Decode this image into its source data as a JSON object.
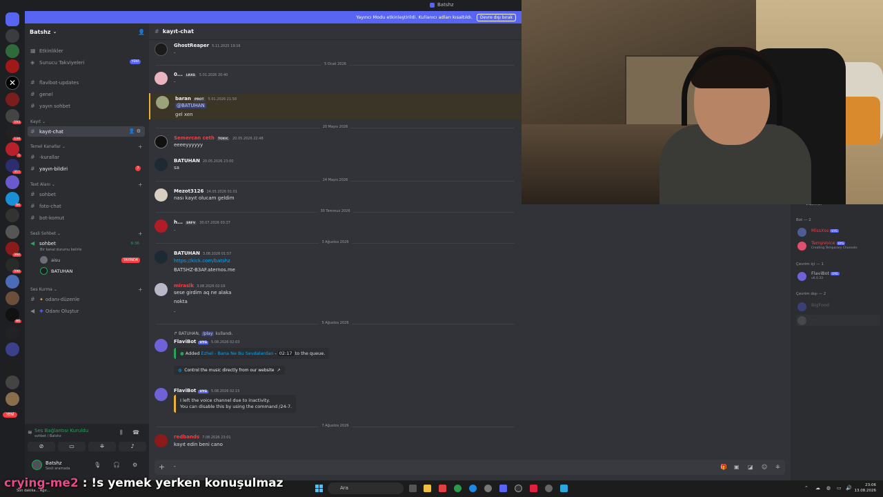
{
  "titlebar": {
    "title": "Batshz"
  },
  "notice": {
    "text": "Yayıncı Modu etkinleştirildi. Kullanıcı adları kısaltıldı.",
    "button": "Devre dışı bırak"
  },
  "rail": {
    "new_label": "YENİ",
    "badges": [
      "193",
      "134",
      "5",
      "86",
      "360",
      "590",
      "86",
      "311"
    ]
  },
  "server": {
    "name": "Batshz"
  },
  "sidebar": {
    "top_items": [
      {
        "label": "Etkinlikler"
      },
      {
        "label": "Sunucu Takviyeleri",
        "badge": "YENİ"
      }
    ],
    "channels_a": [
      "flavibot-updates",
      "genel",
      "yayın sohbet"
    ],
    "cat_kayit": "Kayıt",
    "active_channel": "kayıt-chat",
    "cat_temel": "Temel Kanallar",
    "channels_temel": [
      "-kurallar",
      "yayın-bildiri"
    ],
    "temel_badge": "7",
    "cat_text": "Text Alanı",
    "channels_text": [
      "sohbet",
      "foto-chat",
      "bot-komut"
    ],
    "cat_sesli": "Sesli Sohbet",
    "voice_channel": "sohbet",
    "voice_status": "Bir kanal durumu belirle",
    "voice_timer": "6:36",
    "voice_users": [
      {
        "name": "aisu",
        "badge": "YAYINDA"
      },
      {
        "name": "BATUHAN"
      }
    ],
    "cat_ses_kurma": "Ses Kurma",
    "channels_ses": [
      "odanı-düzenle",
      "Odanı Oluştur"
    ]
  },
  "voicebar": {
    "title": "Ses Bağlantısı Kuruldu",
    "sub": "sohbet / Batshz",
    "user": "Batshz",
    "user_status": "Sesli aramada"
  },
  "header": {
    "channel": "kayıt-chat"
  },
  "messages": [
    {
      "name": "GhostReaper",
      "time": "5.11.2025 19:16",
      "text": "."
    },
    {
      "divider": "5 Ocak 2026"
    },
    {
      "name": "0...",
      "tag": "LRXS",
      "time": "5.01.2026 20:40",
      "text": "."
    },
    {
      "name": "baran",
      "tag": "PROT",
      "time": "5.01.2026 21:58",
      "mention": "@BATUHAN",
      "text": "gel xen"
    },
    {
      "divider": "20 Mayıs 2026"
    },
    {
      "name": "Semercan ceth",
      "name_color": "#f23f43",
      "tag": "TOXIC",
      "time": "20.05.2026 22:48",
      "text": "eeeeyyyyyy"
    },
    {
      "name": "BATUHAN",
      "time": "20.05.2026 23:00",
      "text": "sa"
    },
    {
      "divider": "24 Mayıs 2026"
    },
    {
      "name": "Mezot3126",
      "time": "24.05.2026 01:01",
      "text": "nası kayıt olucam geldim"
    },
    {
      "divider": "30 Temmuz 2026"
    },
    {
      "name": "h...",
      "tag": "SRFV",
      "time": "30.07.2026 03:37",
      "text": "."
    },
    {
      "divider": "3 Ağustos 2026"
    },
    {
      "name": "BATUHAN",
      "time": "3.08.2026 01:57",
      "link": "https://kick.com/batshz",
      "text": "BATSHZ-B3AF.aternos.me"
    },
    {
      "name": "miraslk",
      "name_color": "#f23f43",
      "time": "3.08.2026 02:16",
      "lines": [
        "sese girdim aq ne alaka",
        "nokta",
        "."
      ]
    },
    {
      "divider": "5 Ağustos 2026"
    },
    {
      "reply_user": "BATUHAN",
      "reply_cmd": "/play",
      "reply_suffix": "kullandı.",
      "name": "FlaviBot",
      "app": "UYG",
      "time": "5.08.2026 02:03",
      "embed_prefix": "Added",
      "embed_song": "Ezhel - Bana Ne Bu Sevdalardan",
      "embed_dur": "02:17",
      "embed_suffix": "to the queue.",
      "control": "Control the music directly from our website"
    },
    {
      "name": "FlaviBot",
      "app": "UYG",
      "time": "5.08.2026 02:15",
      "embed_lines": [
        "I left the voice channel due to inactivity.",
        "You can disable this by using the command /24-7."
      ]
    },
    {
      "divider": "7 Ağustos 2026"
    },
    {
      "name": "redbands",
      "name_color": "#f23f43",
      "time": "7.08.2026 23:01",
      "text": "kayıt edin beni cano"
    }
  ],
  "input": {
    "typed": "-"
  },
  "members": {
    "top_partial": "VALORANT",
    "group_bot": "Bot — 2",
    "bots": [
      {
        "name": "MissXss",
        "color": "#f23f43",
        "app": "UYG"
      },
      {
        "name": "TempVoice",
        "color": "#f23f43",
        "app": "UYG",
        "status": "Creating Temporary Channels"
      }
    ],
    "group_online": "Çevrim içi — 1",
    "online": [
      {
        "name": "FlaviBot",
        "app": "UYG",
        "status": "v6.0.33"
      }
    ],
    "group_offline": "Çevrim dışı — 2",
    "offline": [
      {
        "name": "BigFood"
      },
      {
        "name": "..."
      }
    ]
  },
  "taskbar": {
    "search": "Ara",
    "time": "23:06",
    "date": "13.08.2026"
  },
  "subtitle": {
    "user": "crying-me2",
    "text": ": !s yemek yerken konuşulmaz"
  },
  "mini_status": "Son dakika... Ağır..."
}
